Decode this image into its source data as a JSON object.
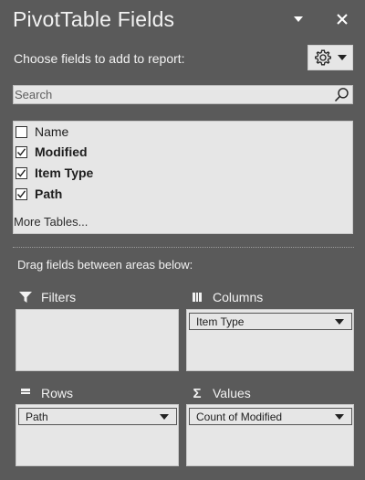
{
  "header": {
    "title": "PivotTable Fields",
    "dropdown_icon": "triangle-down",
    "close_icon": "close"
  },
  "subtitle": "Choose fields to add to report:",
  "settings_button": {
    "icon": "gear-icon"
  },
  "search": {
    "placeholder": "Search",
    "value": ""
  },
  "fields": [
    {
      "label": "Name",
      "checked": false
    },
    {
      "label": "Modified",
      "checked": true
    },
    {
      "label": "Item Type",
      "checked": true
    },
    {
      "label": "Path",
      "checked": true
    }
  ],
  "more_tables": "More Tables...",
  "drag_label": "Drag fields between areas below:",
  "areas": {
    "filters": {
      "label": "Filters",
      "items": []
    },
    "columns": {
      "label": "Columns",
      "items": [
        "Item Type"
      ]
    },
    "rows": {
      "label": "Rows",
      "items": [
        "Path"
      ]
    },
    "values": {
      "label": "Values",
      "items": [
        "Count of Modified"
      ]
    }
  },
  "colors": {
    "background": "#5a5a5a",
    "panel": "#e6e6e6",
    "text_light": "#f2f2f2",
    "text_dark": "#1e1e1e"
  }
}
